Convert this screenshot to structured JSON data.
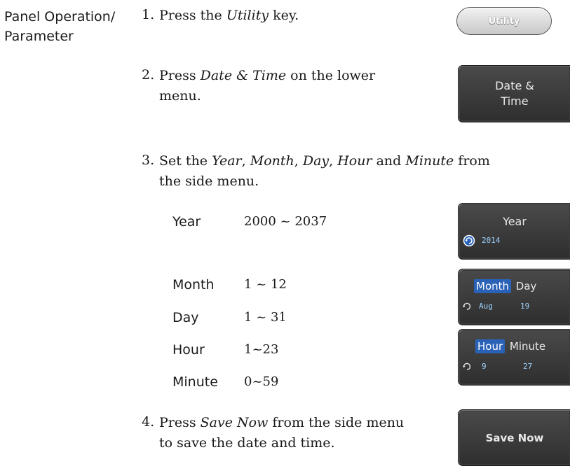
{
  "section_label": "Panel Operation/ Parameter",
  "steps": [
    {
      "num": "1.",
      "text_before": "Press the ",
      "italic": "Utility",
      "text_after": " key."
    },
    {
      "num": "2.",
      "text_before": "Press ",
      "italic": "Date & Time",
      "text_after": " on the lower",
      "line2": "menu."
    },
    {
      "num": "3.",
      "line1_a": "Set the ",
      "line1_year": "Year",
      "line1_b": ", ",
      "line1_month": "Month",
      "line1_c": ", ",
      "line1_day": "Day",
      "line1_d": ", ",
      "line1_hour": "Hour",
      "line1_e": " and ",
      "line1_minute": "Minute",
      "line1_f": " from",
      "line2": "the side menu."
    },
    {
      "num": "4.",
      "text_before": "Press ",
      "italic": "Save Now",
      "text_after": " from the side menu",
      "line2": "to save the date and time."
    }
  ],
  "parameters": [
    {
      "name": "Year",
      "range": "2000 ~ 2037"
    },
    {
      "name": "Month",
      "range": "1 ~ 12"
    },
    {
      "name": "Day",
      "range": "1 ~ 31"
    },
    {
      "name": "Hour",
      "range": "1~23"
    },
    {
      "name": "Minute",
      "range": "0~59"
    }
  ],
  "keys": {
    "utility": "Utility",
    "date_time_line1": "Date &",
    "date_time_line2": "Time",
    "year_title": "Year",
    "year_value": "2014",
    "month_title": "Month",
    "day_title": "Day",
    "month_value": "Aug",
    "day_value": "19",
    "hour_title": "Hour",
    "minute_title": "Minute",
    "hour_value": "9",
    "minute_value": "27",
    "save_now": "Save Now"
  },
  "colors": {
    "softkey_bg": "#3a3a3a",
    "highlight": "#2a62b8",
    "value_text": "#9fd3ff"
  }
}
